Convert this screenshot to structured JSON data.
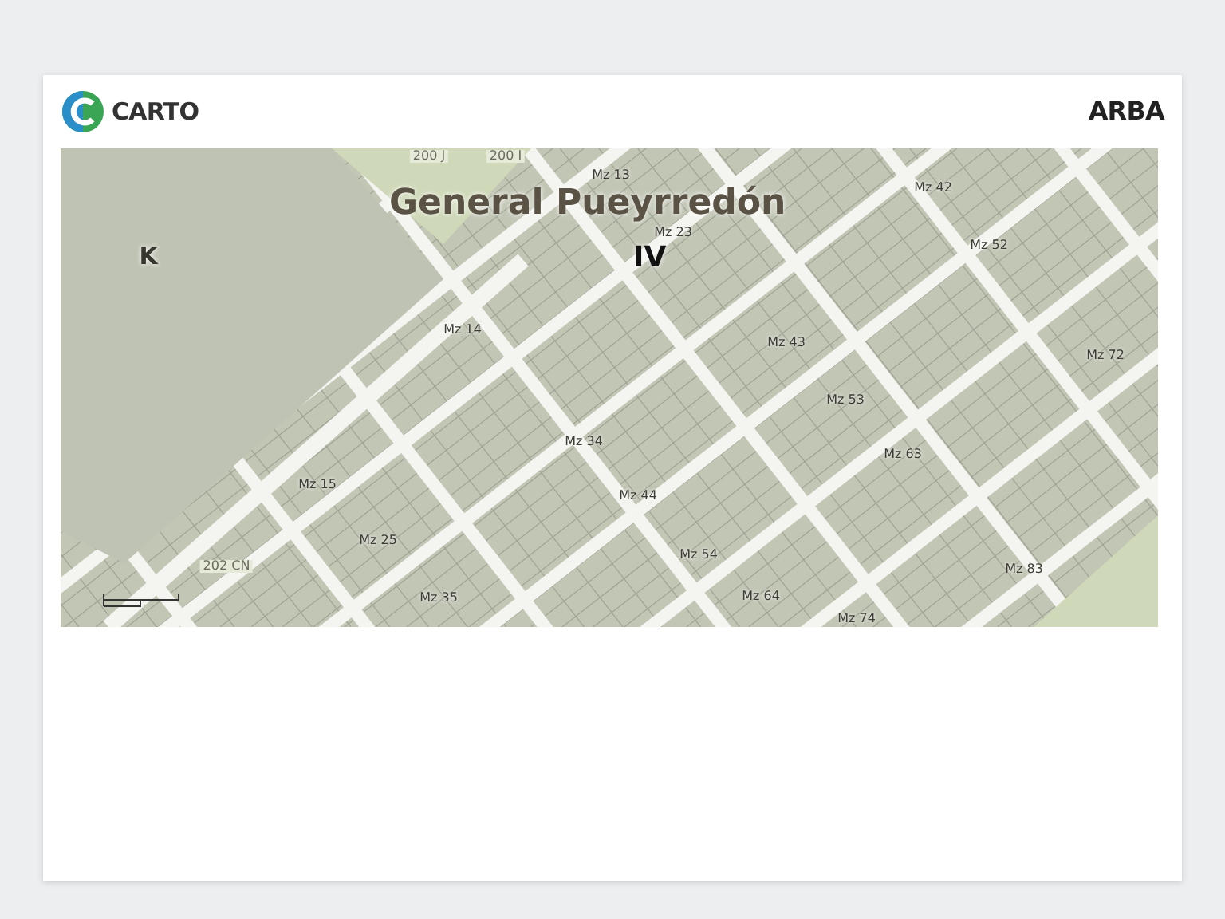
{
  "header": {
    "left_logo": "CARTO",
    "right_logo": "ARBA"
  },
  "map": {
    "title": "General Pueyrredón",
    "subtitle": "IV",
    "labels": [
      {
        "kind": "zone",
        "text": "K"
      },
      {
        "kind": "parcel",
        "text": "200 J"
      },
      {
        "kind": "parcel",
        "text": "200 I"
      },
      {
        "kind": "parcel",
        "text": "202 CN"
      },
      {
        "kind": "block",
        "text": "Mz 13"
      },
      {
        "kind": "block",
        "text": "Mz 23"
      },
      {
        "kind": "block",
        "text": "Mz 42"
      },
      {
        "kind": "block",
        "text": "Mz 52"
      },
      {
        "kind": "block",
        "text": "Mz 14"
      },
      {
        "kind": "block",
        "text": "Mz 43"
      },
      {
        "kind": "block",
        "text": "Mz 72"
      },
      {
        "kind": "block",
        "text": "Mz 53"
      },
      {
        "kind": "block",
        "text": "Mz 34"
      },
      {
        "kind": "block",
        "text": "Mz 63"
      },
      {
        "kind": "block",
        "text": "Mz 15"
      },
      {
        "kind": "block",
        "text": "Mz 44"
      },
      {
        "kind": "block",
        "text": "Mz 25"
      },
      {
        "kind": "block",
        "text": "Mz 54"
      },
      {
        "kind": "block",
        "text": "Mz 83"
      },
      {
        "kind": "block",
        "text": "Mz 35"
      },
      {
        "kind": "block",
        "text": "Mz 64"
      },
      {
        "kind": "block",
        "text": "Mz 74"
      }
    ]
  }
}
